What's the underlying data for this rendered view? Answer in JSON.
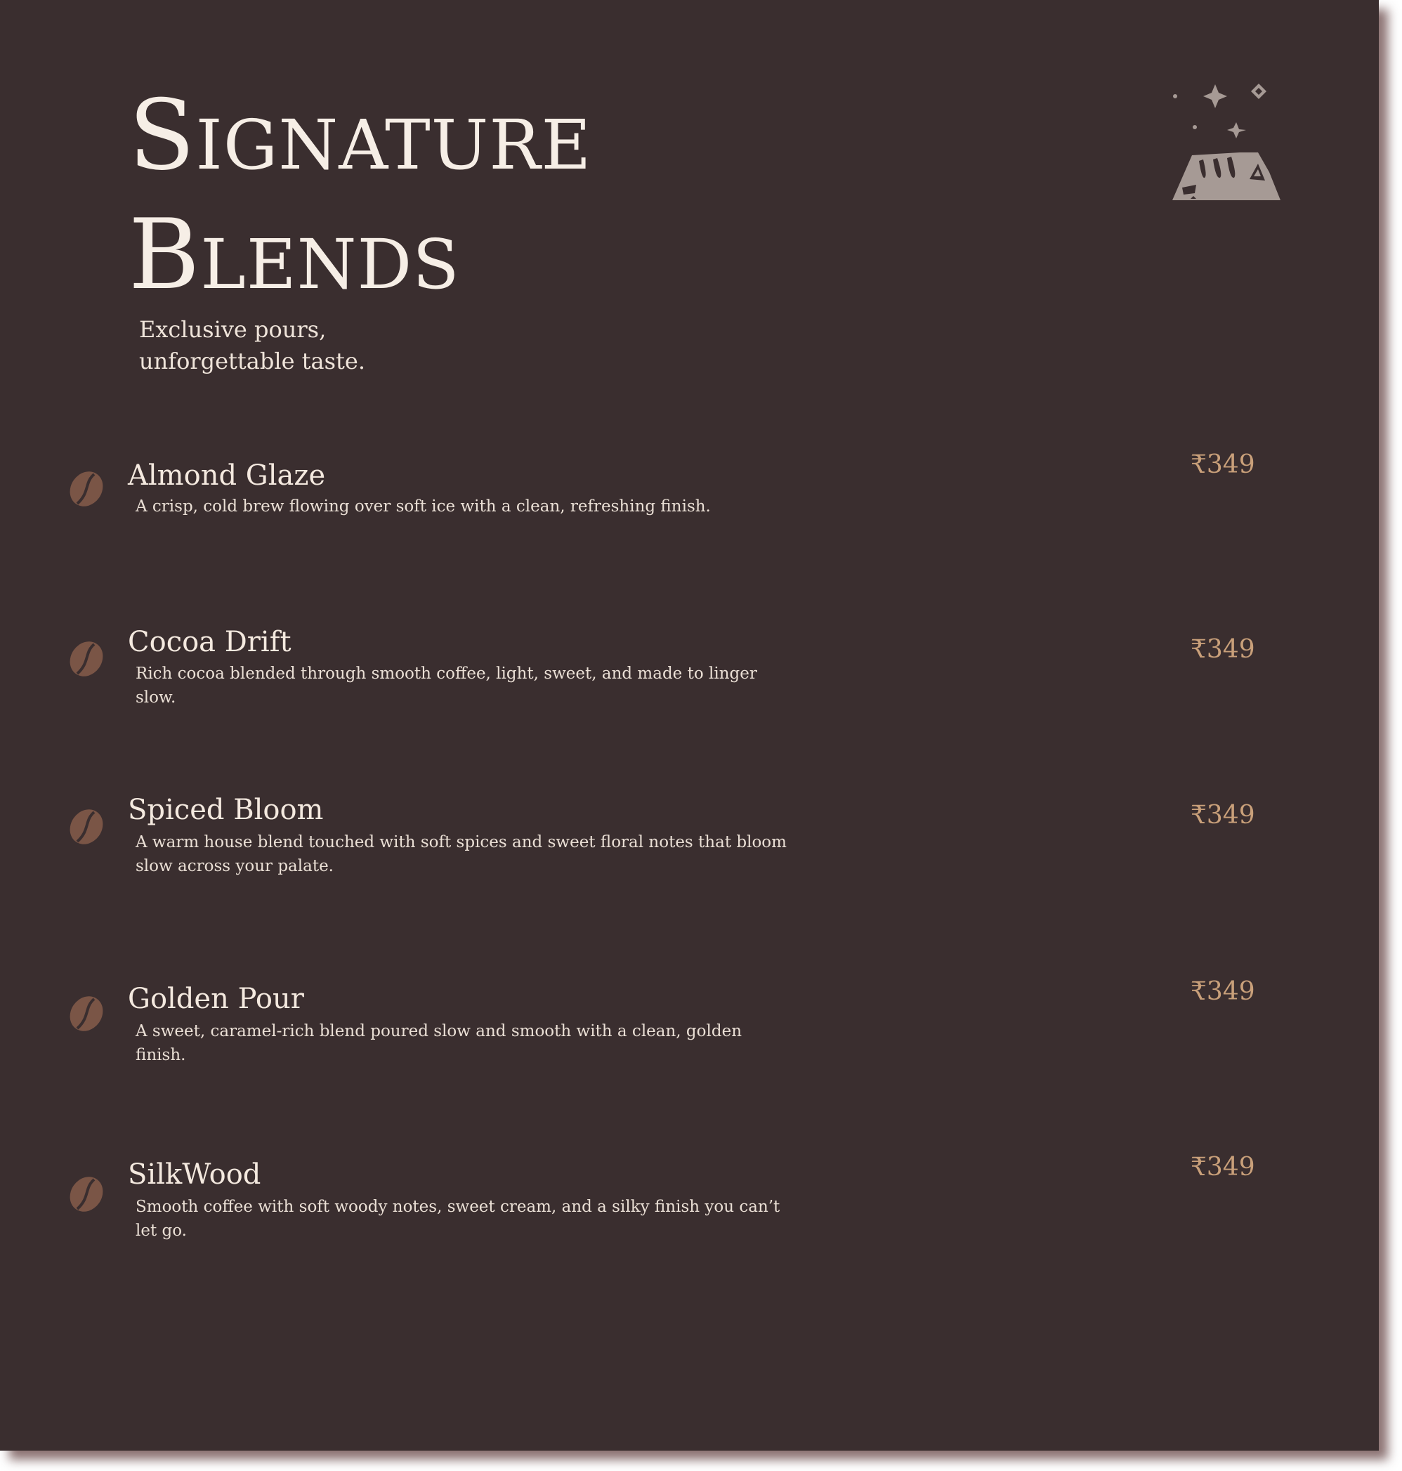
{
  "menu": {
    "title_line1": "Signature",
    "title_line2": "Blends",
    "subtitle_line1": "Exclusive pours,",
    "subtitle_line2": "unforgettable taste.",
    "logo_icon": "coffee-bean-pile-sparkle-icon",
    "bean_icon": "coffee-bean-icon",
    "colors": {
      "background": "#3a2e2f",
      "text": "#f4e9df",
      "price": "#c9a07a",
      "bean": "#7a5546",
      "logo": "#a69a95"
    },
    "items": [
      {
        "name": "Almond Glaze",
        "description": "A crisp, cold brew flowing over soft ice with a clean, refreshing finish.",
        "price": "₹349"
      },
      {
        "name": "Cocoa Drift",
        "description": "Rich cocoa blended through smooth coffee, light, sweet, and made to linger slow.",
        "price": "₹349"
      },
      {
        "name": "Spiced Bloom",
        "description": "A warm house blend touched with soft spices and sweet floral notes that bloom slow across your palate.",
        "price": "₹349"
      },
      {
        "name": "Golden Pour",
        "description": "A sweet, caramel-rich blend poured slow and smooth with a clean, golden finish.",
        "price": "₹349"
      },
      {
        "name": "SilkWood",
        "description": "Smooth coffee with soft woody notes, sweet cream, and a silky finish you can’t let go.",
        "price": "₹349"
      }
    ]
  }
}
